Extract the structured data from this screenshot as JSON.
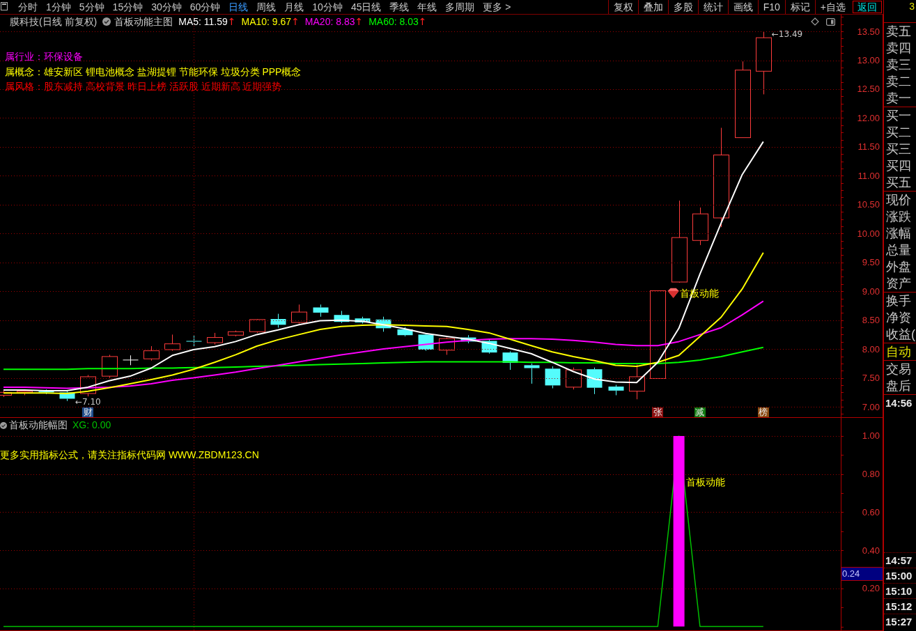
{
  "toolbar": {
    "periods": [
      {
        "label": "分时",
        "selected": false
      },
      {
        "label": "1分钟",
        "selected": false
      },
      {
        "label": "5分钟",
        "selected": false
      },
      {
        "label": "15分钟",
        "selected": false
      },
      {
        "label": "30分钟",
        "selected": false
      },
      {
        "label": "60分钟",
        "selected": false
      },
      {
        "label": "日线",
        "selected": true
      },
      {
        "label": "周线",
        "selected": false
      },
      {
        "label": "月线",
        "selected": false
      },
      {
        "label": "10分钟",
        "selected": false
      },
      {
        "label": "45日线",
        "selected": false
      },
      {
        "label": "季线",
        "selected": false
      },
      {
        "label": "年线",
        "selected": false
      },
      {
        "label": "多周期",
        "selected": false
      },
      {
        "label": "更多 >",
        "selected": false
      }
    ],
    "buttons": [
      {
        "label": "复权",
        "kind": "normal"
      },
      {
        "label": "叠加",
        "kind": "normal"
      },
      {
        "label": "多股",
        "kind": "normal"
      },
      {
        "label": "统计",
        "kind": "normal"
      },
      {
        "label": "画线",
        "kind": "normal"
      },
      {
        "label": "F10",
        "kind": "normal"
      },
      {
        "label": "标记",
        "kind": "normal"
      },
      {
        "label": "+自选",
        "kind": "normal"
      },
      {
        "label": "返回",
        "kind": "accent"
      }
    ]
  },
  "main_chart": {
    "title": "膜科技(日线 前复权)",
    "indicator": "首板动能主图",
    "legend": [
      {
        "text": "MA5: 11.59",
        "color": "#ffffff",
        "arrow": "↑"
      },
      {
        "text": "MA10: 9.67",
        "color": "#ffff00",
        "arrow": "↑"
      },
      {
        "text": "MA20: 8.83",
        "color": "#ff00ff",
        "arrow": "↑"
      },
      {
        "text": "MA60: 8.03",
        "color": "#00ff00",
        "arrow": "↑"
      }
    ],
    "info_lines": [
      {
        "text": "属行业：环保设备",
        "color": "#ff00ff"
      },
      {
        "text": "属概念：雄安新区 锂电池概念 盐湖提锂 节能环保 垃圾分类 PPP概念",
        "color": "#ffff00"
      },
      {
        "text": "属风格：股东减持 高校背景 昨日上榜 活跃股 近期新高 近期强势",
        "color": "#ff0000"
      }
    ],
    "event_tags": [
      {
        "text": "财",
        "color": "#1f4e8c"
      },
      {
        "text": "张",
        "color": "#8b1010"
      },
      {
        "text": "减",
        "color": "#107a10"
      },
      {
        "text": "榜",
        "color": "#8b4a10"
      }
    ],
    "chart_data": {
      "type": "line",
      "categories": [
        null,
        null,
        null,
        null,
        null,
        null,
        null,
        null,
        null,
        null,
        null,
        null,
        null,
        null,
        null,
        null,
        null,
        null,
        null,
        null,
        null,
        null,
        null,
        null,
        null,
        null,
        null,
        null,
        null,
        null,
        null,
        null,
        null,
        null,
        null,
        null,
        null
      ],
      "ylim": [
        6.82,
        13.79
      ],
      "grid": true,
      "yticks": [
        {
          "value": 7,
          "label": "7.00"
        },
        {
          "value": 7.5,
          "label": "7.50"
        },
        {
          "value": 8,
          "label": "8.00"
        },
        {
          "value": 8.5,
          "label": "8.50"
        },
        {
          "value": 9,
          "label": "9.00"
        },
        {
          "value": 9.5,
          "label": "9.50"
        },
        {
          "value": 10,
          "label": "10.00"
        },
        {
          "value": 10.5,
          "label": "10.50"
        },
        {
          "value": 11,
          "label": "11.00"
        },
        {
          "value": 11.5,
          "label": "11.50"
        },
        {
          "value": 12,
          "label": "12.00"
        },
        {
          "value": 12.5,
          "label": "12.50"
        },
        {
          "value": 13,
          "label": "13.00"
        },
        {
          "value": 13.5,
          "label": "13.50"
        }
      ],
      "series": [
        {
          "color": "#00ff00",
          "values": [
            7.65,
            7.65,
            7.65,
            7.65,
            7.66,
            7.66,
            7.66,
            7.67,
            7.67,
            7.68,
            7.68,
            7.69,
            7.7,
            7.71,
            7.72,
            7.73,
            7.74,
            7.75,
            7.76,
            7.77,
            7.78,
            7.78,
            7.78,
            7.78,
            7.78,
            7.77,
            7.77,
            7.76,
            7.76,
            7.75,
            7.75,
            7.75,
            7.77,
            7.81,
            7.87,
            7.95,
            8.03
          ]
        },
        {
          "color": "#ff00ff",
          "values": [
            7.34,
            7.34,
            7.33,
            7.32,
            7.33,
            7.34,
            7.36,
            7.4,
            7.46,
            7.5,
            7.55,
            7.6,
            7.66,
            7.72,
            7.78,
            7.84,
            7.9,
            7.95,
            8.0,
            8.04,
            8.08,
            8.12,
            8.15,
            8.17,
            8.18,
            8.18,
            8.17,
            8.15,
            8.12,
            8.08,
            8.06,
            8.06,
            8.13,
            8.25,
            8.37,
            8.59,
            8.83
          ]
        },
        {
          "color": "#ffff00",
          "values": [
            7.24,
            7.24,
            7.24,
            7.23,
            7.27,
            7.33,
            7.4,
            7.47,
            7.55,
            7.65,
            7.77,
            7.9,
            8.05,
            8.16,
            8.25,
            8.34,
            8.39,
            8.41,
            8.42,
            8.41,
            8.4,
            8.39,
            8.34,
            8.28,
            8.17,
            8.06,
            7.95,
            7.87,
            7.8,
            7.72,
            7.7,
            7.77,
            7.89,
            8.22,
            8.55,
            9.04,
            9.67
          ]
        },
        {
          "color": "#ffffff",
          "values": [
            7.29,
            7.29,
            7.28,
            7.28,
            7.34,
            7.45,
            7.53,
            7.67,
            7.89,
            7.99,
            8.04,
            8.13,
            8.25,
            8.33,
            8.42,
            8.49,
            8.5,
            8.48,
            8.42,
            8.35,
            8.27,
            8.22,
            8.17,
            8.1,
            8.01,
            7.92,
            7.77,
            7.61,
            7.48,
            7.43,
            7.42,
            7.77,
            8.36,
            9.3,
            10.18,
            11.02,
            11.59
          ]
        }
      ],
      "annotations": [
        "←7.10",
        "←13.49",
        "首板动能"
      ]
    }
  },
  "sub_chart": {
    "indicator": "首板动能幅图",
    "legend": [
      {
        "text": "XG: 0.00",
        "color": "#00c000"
      }
    ],
    "note": "更多实用指标公式，请关注指标代码网 WWW.ZBDM123.CN",
    "cursor_value": "0.24",
    "chart_data": {
      "type": "bar",
      "categories": [
        null,
        null,
        null,
        null,
        null,
        null,
        null,
        null,
        null,
        null,
        null,
        null,
        null,
        null,
        null,
        null,
        null,
        null,
        null,
        null,
        null,
        null,
        null,
        null,
        null,
        null,
        null,
        null,
        null,
        null,
        null,
        null,
        null,
        null,
        null,
        null,
        null
      ],
      "ylim": [
        -0.02,
        1.095
      ],
      "grid": true,
      "yticks": [
        {
          "value": 0.2,
          "label": "0.20"
        },
        {
          "value": 0.4,
          "label": "0.40"
        },
        {
          "value": 0.6,
          "label": "0.60"
        },
        {
          "value": 0.8,
          "label": "0.80"
        },
        {
          "value": 1,
          "label": "1.00"
        }
      ],
      "series": [
        {
          "type": "line",
          "color": "#00c000",
          "values": [
            0,
            0,
            0,
            0,
            0,
            0,
            0,
            0,
            0,
            0,
            0,
            0,
            0,
            0,
            0,
            0,
            0,
            0,
            0,
            0,
            0,
            0,
            0,
            0,
            0,
            0,
            0,
            0,
            0,
            0,
            0,
            0,
            1,
            0,
            0,
            0,
            0
          ]
        },
        {
          "color": "#ff00ff",
          "values": [
            0,
            0,
            0,
            0,
            0,
            0,
            0,
            0,
            0,
            0,
            0,
            0,
            0,
            0,
            0,
            0,
            0,
            0,
            0,
            0,
            0,
            0,
            0,
            0,
            0,
            0,
            0,
            0,
            0,
            0,
            0,
            0,
            1,
            0,
            0,
            0,
            0
          ]
        }
      ],
      "annotations": [
        "首板动能"
      ]
    }
  },
  "quote_panel": {
    "header_text": "3",
    "groups": [
      {
        "kind": "normal",
        "rows": [
          "卖五",
          "卖四",
          "卖三",
          "卖二",
          "卖一"
        ]
      },
      {
        "kind": "normal",
        "rows": [
          "买一",
          "买二",
          "买三",
          "买四",
          "买五"
        ]
      },
      {
        "kind": "normal",
        "rows": [
          "现价",
          "涨跌",
          "涨幅",
          "总量",
          "外盘",
          "资产"
        ]
      },
      {
        "kind": "normal",
        "rows": [
          "换手",
          "净资",
          "收益("
        ]
      },
      {
        "kind": "highlight",
        "rows": [
          "自动"
        ]
      },
      {
        "kind": "normal",
        "rows": [
          "交易",
          "盘后"
        ]
      }
    ],
    "time_top": [
      "14:56"
    ],
    "time_bottom": [
      "14:57",
      "15:00",
      "15:10",
      "15:12",
      "15:27"
    ]
  }
}
